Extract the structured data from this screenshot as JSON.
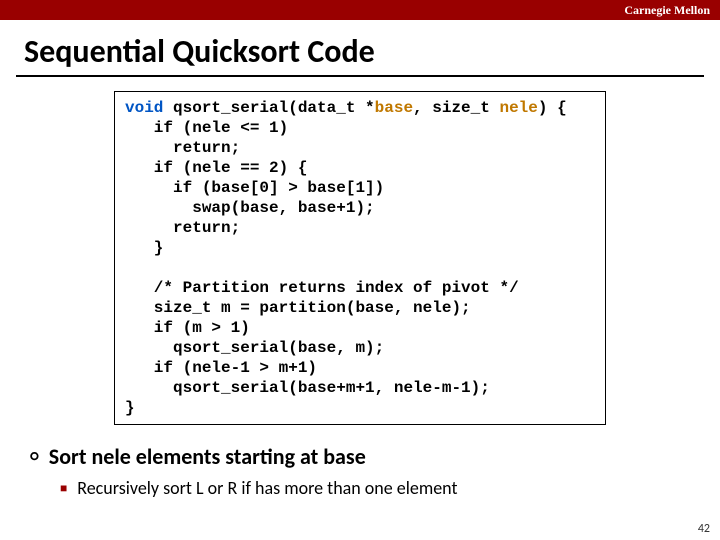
{
  "header": {
    "brand": "Carnegie Mellon"
  },
  "title": "Sequential Quicksort Code",
  "code": {
    "l1a": "void",
    "l1b": " qsort_serial(data_t *",
    "l1c": "base",
    "l1d": ", size_t ",
    "l1e": "nele",
    "l1f": ") {",
    "l2": "   if (nele <= 1)",
    "l3": "     return;",
    "l4": "   if (nele == 2) {",
    "l5": "     if (base[0] > base[1])",
    "l6": "       swap(base, base+1);",
    "l7": "     return;",
    "l8": "   }",
    "l9": "",
    "l10": "   /* Partition returns index of pivot */",
    "l11": "   size_t m = partition(base, nele);",
    "l12": "   if (m > 1)",
    "l13": "     qsort_serial(base, m);",
    "l14": "   if (nele-1 > m+1)",
    "l15": "     qsort_serial(base+m+1, nele-m-1);",
    "l16": "}"
  },
  "bullets": {
    "main": "Sort nele elements starting at base",
    "sub": "Recursively sort L or R if has more than one element"
  },
  "page": "42"
}
